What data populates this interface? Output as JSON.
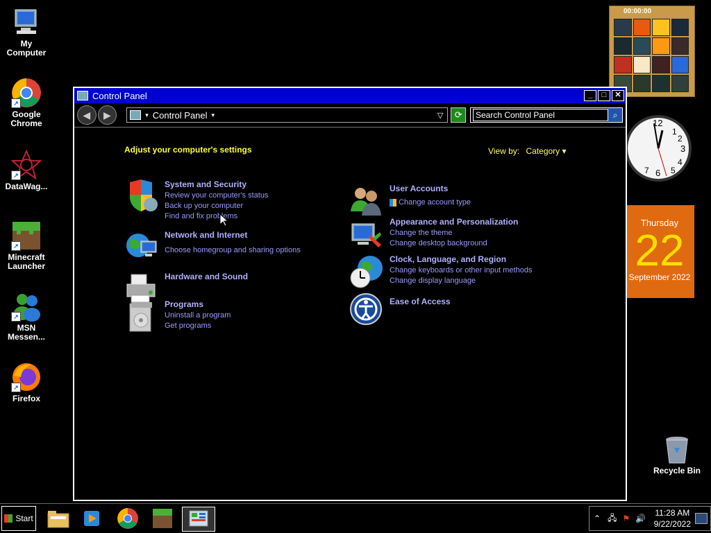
{
  "desktop": {
    "icons": [
      {
        "label": "My Computer",
        "icon": "computer-icon"
      },
      {
        "label": "Google Chrome",
        "icon": "chrome-icon"
      },
      {
        "label": "DataWag...",
        "icon": "datawag-icon"
      },
      {
        "label": "Minecraft Launcher",
        "icon": "minecraft-icon"
      },
      {
        "label": "MSN Messen...",
        "icon": "msn-icon"
      },
      {
        "label": "Firefox",
        "icon": "firefox-icon"
      }
    ],
    "recycle_bin": "Recycle Bin"
  },
  "gadgets": {
    "puzzle_timer": "00:00:00",
    "calendar_day": "Thursday",
    "calendar_date": "22",
    "calendar_month": "September 2022"
  },
  "window": {
    "title": "Control Panel",
    "address": "Control Panel",
    "search_placeholder": "Search Control Panel",
    "heading": "Adjust your computer's settings",
    "view_by_label": "View by:",
    "view_by_value": "Category",
    "categories_left": [
      {
        "title": "System and Security",
        "links": [
          "Review your computer's status",
          "Back up your computer",
          "Find and fix problems"
        ]
      },
      {
        "title": "Network and Internet",
        "links": [
          "Choose homegroup and sharing options"
        ]
      },
      {
        "title": "Hardware and Sound",
        "links": []
      },
      {
        "title": "Programs",
        "links": [
          "Uninstall a program",
          "Get programs"
        ]
      }
    ],
    "categories_right": [
      {
        "title": "User Accounts",
        "links": [
          "Change account type"
        ]
      },
      {
        "title": "Appearance and Personalization",
        "links": [
          "Change the theme",
          "Change desktop background"
        ]
      },
      {
        "title": "Clock, Language, and Region",
        "links": [
          "Change keyboards or other input methods",
          "Change display language"
        ]
      },
      {
        "title": "Ease of Access",
        "links": []
      }
    ]
  },
  "taskbar": {
    "start_label": "Start",
    "time": "11:28 AM",
    "date": "9/22/2022"
  }
}
